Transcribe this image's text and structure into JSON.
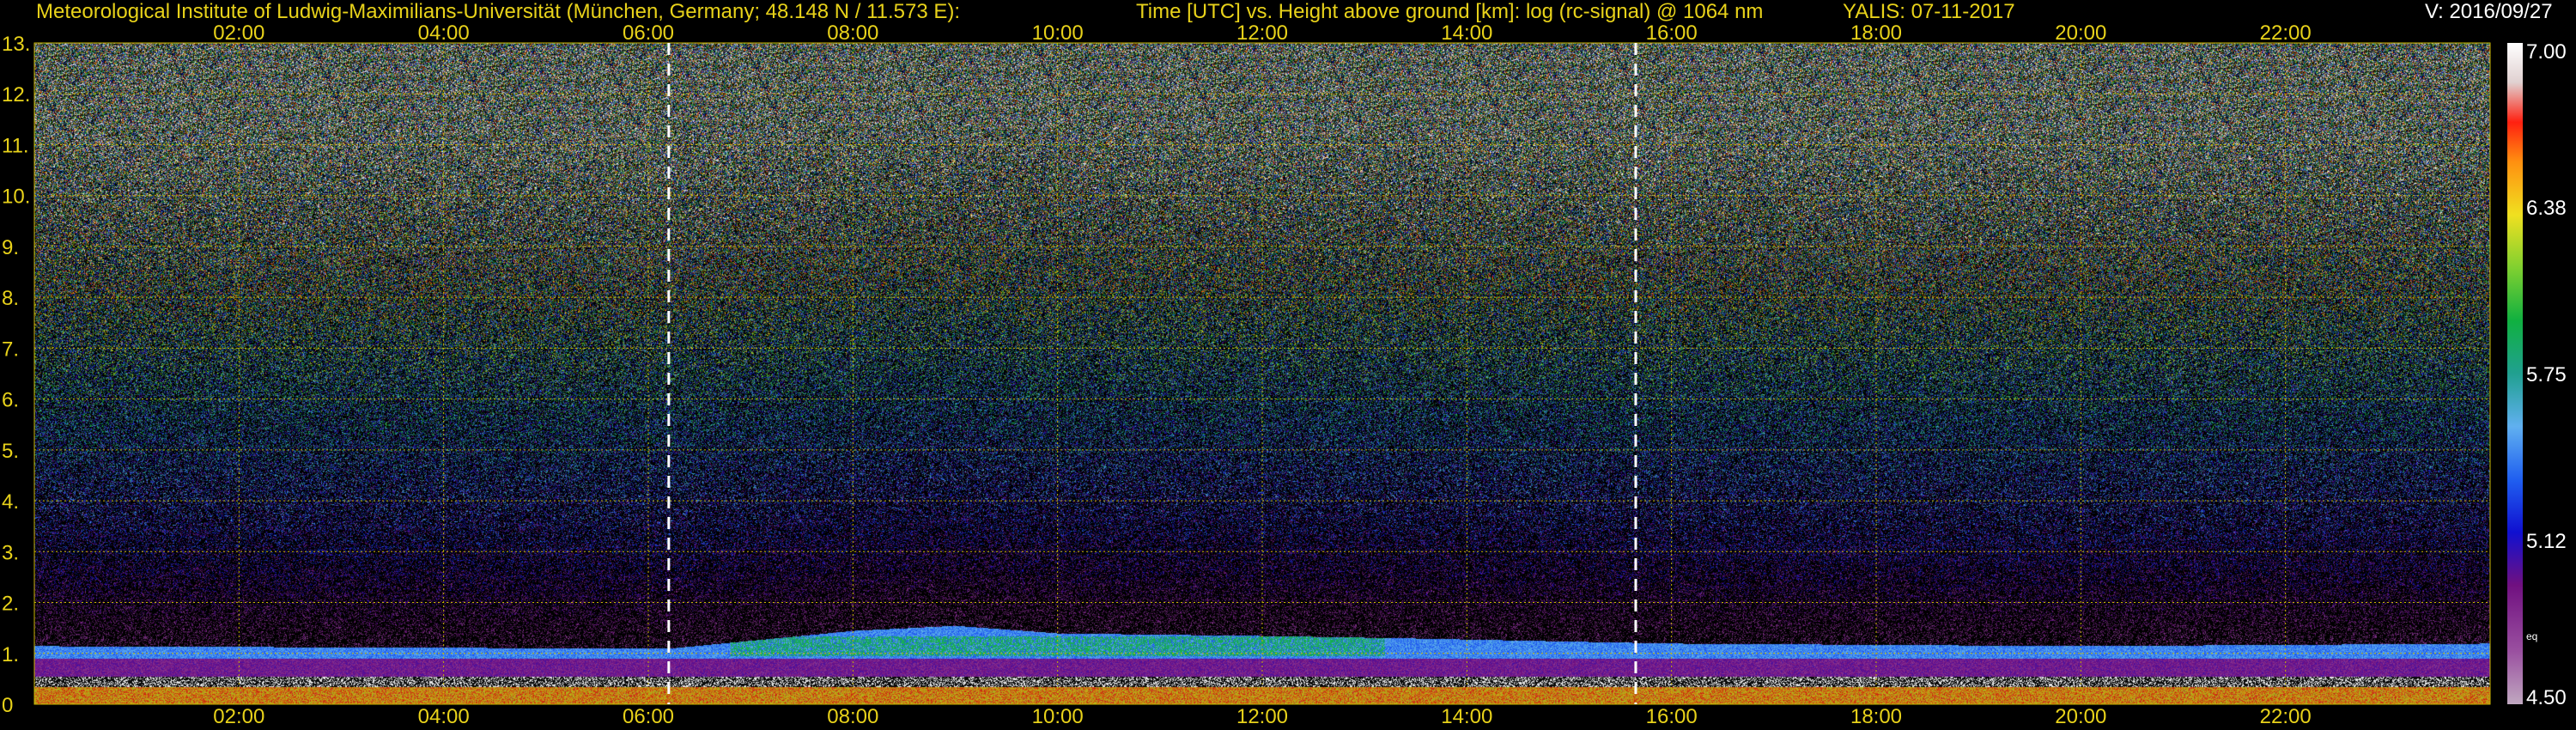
{
  "header": {
    "institute": "Meteorological Institute of Ludwig-Maximilians-Universität (München, Germany; 48.148 N / 11.573 E):",
    "title": "Time [UTC] vs. Height above ground [km]: log (rc-signal) @ 1064 nm",
    "station": "YALIS: 07-11-2017",
    "version": "V: 2016/09/27"
  },
  "colors": {
    "axis_text": "#e8d21a",
    "grid": "#c8b400",
    "white_text": "#ffffff"
  },
  "chart_data": {
    "type": "heatmap",
    "xlabel": "Time [UTC]",
    "ylabel": "Height above ground [km]",
    "x_ticks": [
      "02:00",
      "04:00",
      "06:00",
      "08:00",
      "10:00",
      "12:00",
      "14:00",
      "16:00",
      "18:00",
      "20:00",
      "22:00"
    ],
    "x_tick_hours": [
      2,
      4,
      6,
      8,
      10,
      12,
      14,
      16,
      18,
      20,
      22
    ],
    "xlim_hours": [
      0.0,
      24.0
    ],
    "y_ticks": [
      "0",
      "1.",
      "2.",
      "3.",
      "4.",
      "5.",
      "6.",
      "7.",
      "8.",
      "9.",
      "10.",
      "11.",
      "12.",
      "13."
    ],
    "ylim_km": [
      0,
      13
    ],
    "grid": true,
    "dashed_markers_hours": [
      6.2,
      15.65
    ],
    "colorbar": {
      "labels": [
        "7.00",
        "6.38",
        "5.75",
        "5.12",
        "4.50"
      ],
      "values": [
        7.0,
        6.38,
        5.75,
        5.12,
        4.5
      ],
      "range": [
        4.5,
        7.0
      ],
      "extra_label": "eq"
    },
    "boundary_layer": [
      {
        "t": 0.0,
        "top": 1.15
      },
      {
        "t": 6.2,
        "top": 1.1
      },
      {
        "t": 8.0,
        "top": 1.45
      },
      {
        "t": 9.0,
        "top": 1.55
      },
      {
        "t": 10.0,
        "top": 1.4
      },
      {
        "t": 12.0,
        "top": 1.35
      },
      {
        "t": 13.5,
        "top": 1.3
      },
      {
        "t": 16.0,
        "top": 1.2
      },
      {
        "t": 20.0,
        "top": 1.15
      },
      {
        "t": 24.0,
        "top": 1.2
      }
    ]
  }
}
